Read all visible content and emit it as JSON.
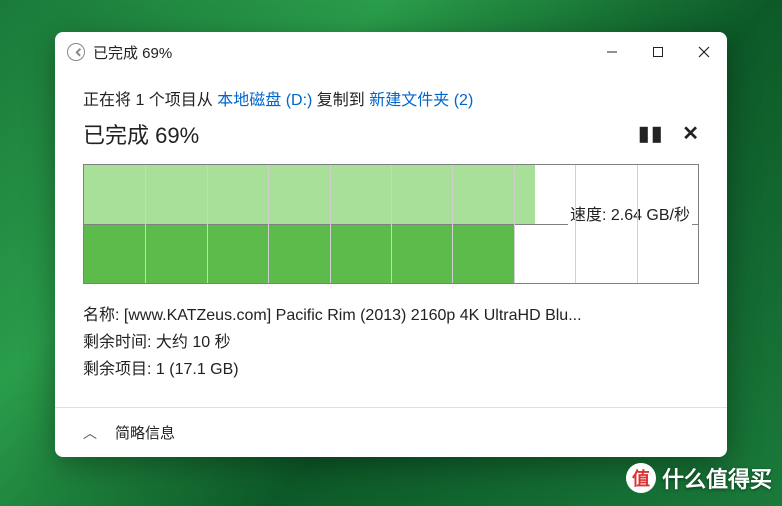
{
  "window": {
    "title": "已完成 69%"
  },
  "copy": {
    "prefix": "正在将 1 个项目从 ",
    "source": "本地磁盘 (D:)",
    "mid": " 复制到 ",
    "dest": "新建文件夹 (2)"
  },
  "progress": {
    "title": "已完成 69%",
    "percent": 69
  },
  "chart_data": {
    "type": "area",
    "title": "",
    "xlabel": "",
    "ylabel": "",
    "x_progress_percent": 69,
    "top_fill_percent": 73.5,
    "bottom_fill_percent": 70,
    "speed_label_prefix": "速度: ",
    "speed_value": "2.64 GB/秒",
    "grid_columns": 10,
    "colors": {
      "top": "#a8e09a",
      "bottom": "#5cbb4a"
    }
  },
  "details": {
    "name_label": "名称: ",
    "name_value": "[www.KATZeus.com] Pacific Rim (2013) 2160p 4K UltraHD Blu...",
    "time_label": "剩余时间: ",
    "time_value": "大约 10 秒",
    "items_label": "剩余项目: ",
    "items_value": "1 (17.1 GB)"
  },
  "footer": {
    "toggle": "简略信息"
  },
  "watermark": {
    "badge": "值",
    "text": "什么值得买"
  }
}
